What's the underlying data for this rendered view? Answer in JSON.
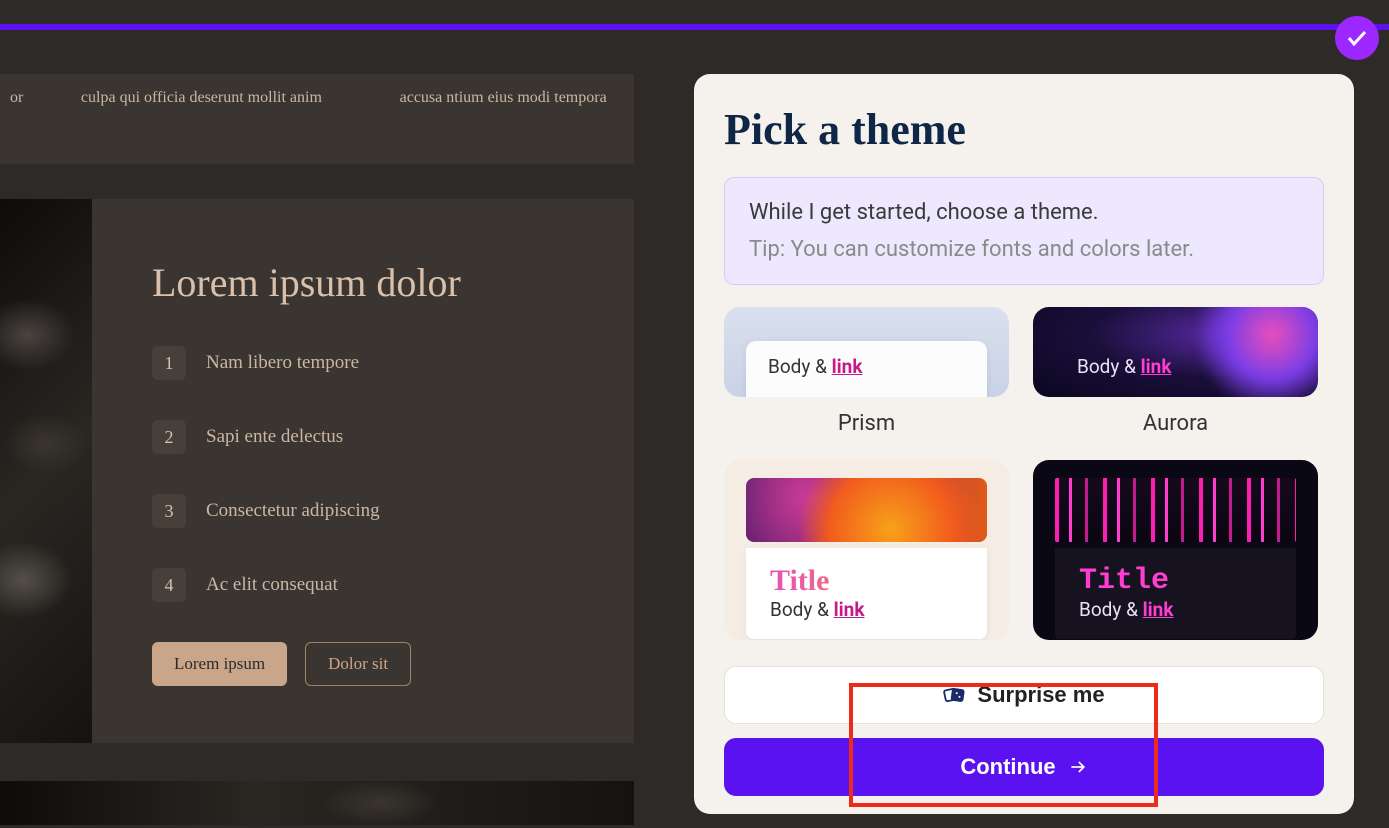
{
  "progress": {
    "complete": true
  },
  "preview": {
    "top_cols": {
      "a": "or",
      "b": "culpa qui officia deserunt mollit anim",
      "c": "accusa ntium eius modi tempora"
    },
    "card": {
      "heading": "Lorem ipsum dolor",
      "items": [
        {
          "num": "1",
          "text": "Nam libero tempore"
        },
        {
          "num": "2",
          "text": "Sapi ente delectus"
        },
        {
          "num": "3",
          "text": "Consectetur adipiscing"
        },
        {
          "num": "4",
          "text": "Ac elit consequat"
        }
      ],
      "button_primary": "Lorem ipsum",
      "button_secondary": "Dolor sit"
    }
  },
  "panel": {
    "title": "Pick a theme",
    "tip_line1": "While I get started, choose a theme.",
    "tip_line2": "Tip: You can customize fonts and colors later.",
    "themes": [
      {
        "name": "Prism",
        "body": "Body & ",
        "link": "link"
      },
      {
        "name": "Aurora",
        "body": "Body & ",
        "link": "link"
      },
      {
        "name": "(flame)",
        "title": "Title",
        "body": "Body & ",
        "link": "link"
      },
      {
        "name": "(neon)",
        "title": "Title",
        "body": "Body & ",
        "link": "link"
      }
    ],
    "surprise_label": "Surprise me",
    "continue_label": "Continue"
  }
}
